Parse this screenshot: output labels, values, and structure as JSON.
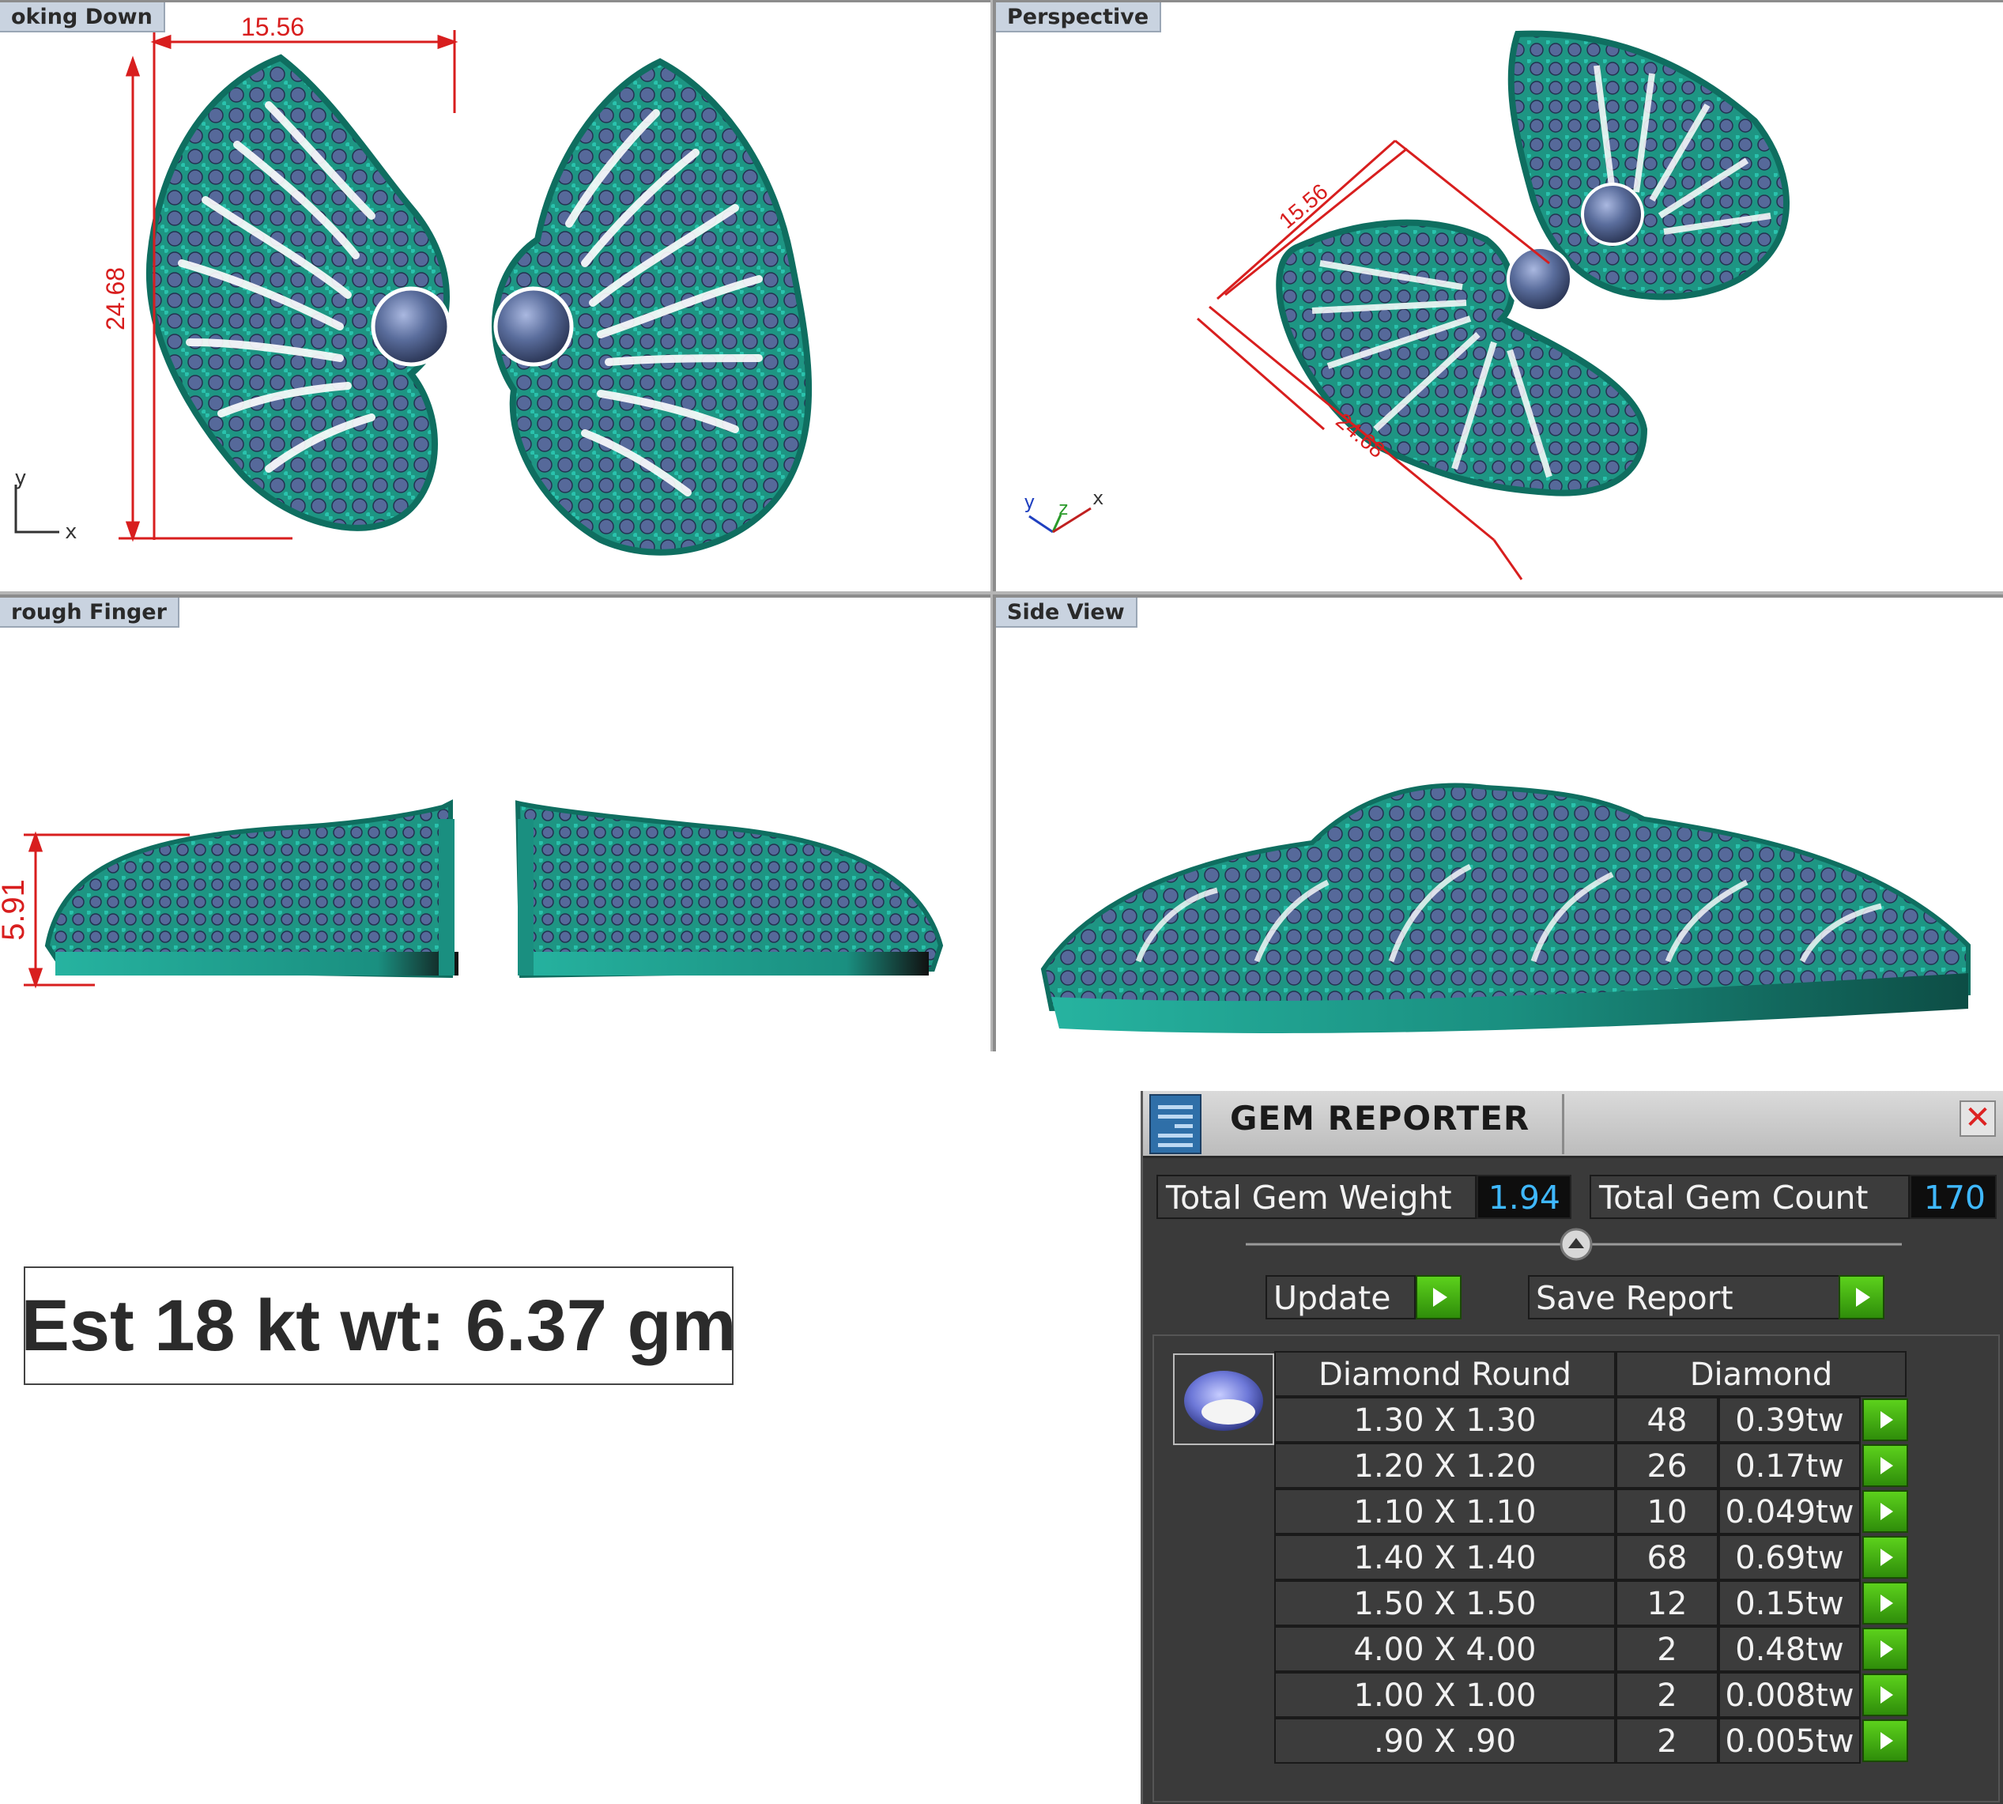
{
  "viewports": {
    "top_left": {
      "label": "oking Down",
      "width_dim": "15.56",
      "height_dim": "24.68",
      "axes": [
        "y",
        "x"
      ]
    },
    "top_right": {
      "label": "Perspective",
      "width_dim": "15.56",
      "height_dim": "24.68",
      "axes": [
        "y",
        "z",
        "x"
      ]
    },
    "bottom_left": {
      "label": "rough Finger",
      "height_dim": "5.91"
    },
    "bottom_right": {
      "label": "Side View"
    }
  },
  "weight_note": "Est 18 kt wt: 6.37 gm",
  "gem_reporter": {
    "title": "GEM REPORTER",
    "close": "✕",
    "total_weight_label": "Total Gem Weight",
    "total_weight_value": "1.94",
    "total_count_label": "Total Gem Count",
    "total_count_value": "170",
    "update_label": "Update",
    "save_report_label": "Save Report",
    "table": {
      "header_shape": "Diamond Round",
      "header_material": "Diamond",
      "rows": [
        {
          "size": "1.30 X 1.30",
          "count": "48",
          "weight": "0.39tw"
        },
        {
          "size": "1.20 X 1.20",
          "count": "26",
          "weight": "0.17tw"
        },
        {
          "size": "1.10 X 1.10",
          "count": "10",
          "weight": "0.049tw"
        },
        {
          "size": "1.40 X 1.40",
          "count": "68",
          "weight": "0.69tw"
        },
        {
          "size": "1.50 X 1.50",
          "count": "12",
          "weight": "0.15tw"
        },
        {
          "size": "4.00 X 4.00",
          "count": "2",
          "weight": "0.48tw"
        },
        {
          "size": "1.00 X 1.00",
          "count": "2",
          "weight": "0.008tw"
        },
        {
          "size": ".90 X .90",
          "count": "2",
          "weight": "0.005tw"
        }
      ]
    }
  },
  "colors": {
    "metal": "#1fa391",
    "gem": "#4a5f8a",
    "dimension": "#d81e1e"
  }
}
